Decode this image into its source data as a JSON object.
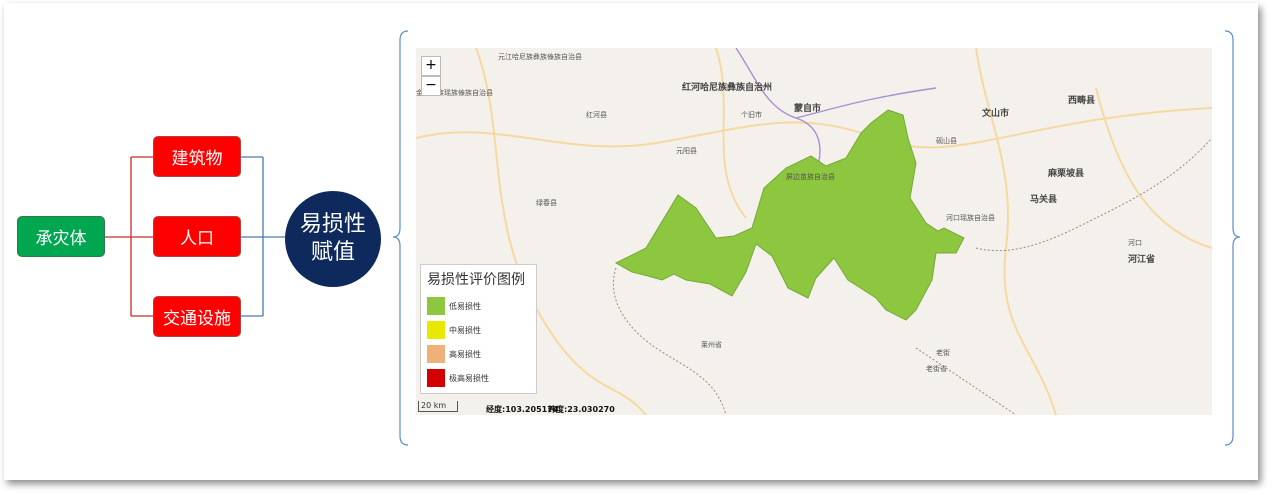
{
  "diagram": {
    "root": "承灾体",
    "children": [
      "建筑物",
      "人口",
      "交通设施"
    ],
    "hub": "易损性赋值"
  },
  "map": {
    "zoom_in": "+",
    "zoom_out": "−",
    "legend": {
      "title": "易损性评价图例",
      "items": [
        {
          "label": "低易损性",
          "color": "#8dc63f"
        },
        {
          "label": "中易损性",
          "color": "#e8e800"
        },
        {
          "label": "高易损性",
          "color": "#f0b07a"
        },
        {
          "label": "极高易损性",
          "color": "#d40000"
        }
      ]
    },
    "scale": "20 km",
    "lon": "经度:103.205174",
    "lat": "纬度:23.030270",
    "labels": [
      "元江哈尼族彝族傣族自治县",
      "红河哈尼族彝族自治州",
      "蒙自市",
      "红河县",
      "元阳县",
      "绿春县",
      "个旧市",
      "文山市",
      "西畴县",
      "马关县",
      "麻栗坡县",
      "河口瑶族自治县",
      "金平苗族瑶族傣族自治县",
      "河江省",
      "莱州省",
      "老街省",
      "砚山县",
      "屏边苗族自治县",
      "河口",
      "老街"
    ]
  }
}
